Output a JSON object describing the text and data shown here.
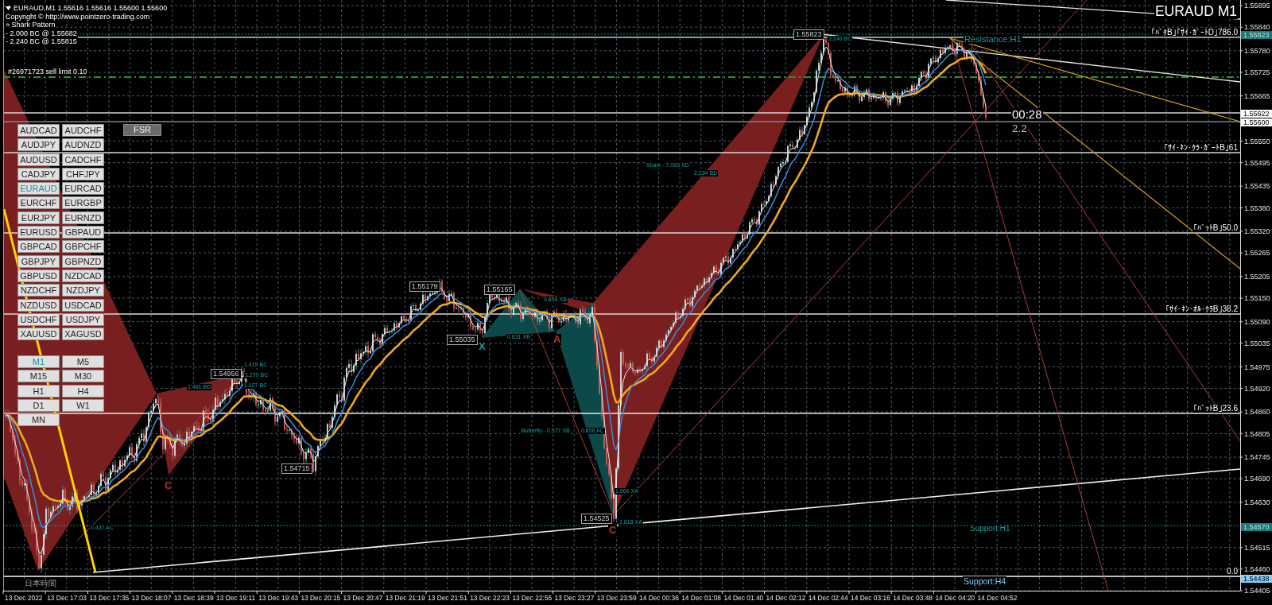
{
  "chart_header": {
    "symbol_line": "EURAUD,M1 1.55616 1.55616 1.55600 1.55600",
    "indicator_lines": [
      "Copyright © http://www.pointzero-trading.com",
      "» Shark Pattern",
      "- 2.000 BC @ 1.55682",
      "- 2.240 BC @ 1.55815"
    ]
  },
  "order_label": "#26971723 sell limit 0.10",
  "chart_title": "EURAUD M1",
  "candle_timer": {
    "countdown": "00:28",
    "spread": "2.2"
  },
  "level_labels": [
    "｢ﾊﾞﾀB｣｢ｻｲ･ｶﾞｰﾄD｣786.0",
    "｢ｻｲ･ﾈﾝ･ｸﾗ･ｶﾞｰﾄB｣61",
    "｢ﾊﾞｯﾄB｣50.0",
    "｢ｻｲ･ﾈﾝ･ｵﾙ･ｸﾗB｣38.2",
    "｢ﾊﾞｯﾄB｣23.6",
    "0.0"
  ],
  "zone_labels": [
    {
      "text": "Resistance:H1",
      "color": "#1f9c9c"
    },
    {
      "text": "Support:H1",
      "color": "#1f9c9c"
    },
    {
      "text": "Support:H4",
      "color": "#87cefa"
    }
  ],
  "point_labels": [
    "1.55823",
    "1.55179",
    "1.55165",
    "1.55035",
    "1.54956",
    "1.54715",
    "1.54525"
  ],
  "pattern_notes": [
    "2.240 BC",
    "Shark - 7.093 XD",
    "2.234 BD",
    "0.659 XB",
    "0.631 XB",
    "1.419 BC",
    "1.270 BC",
    "1.461 BD",
    "1.127 BC",
    "Butterfly - 0.577 XB",
    "0.858 AC",
    "1.000 XA",
    "1.618 XA",
    "0.437 AC"
  ],
  "point_letters": [
    {
      "text": "A",
      "color": "#b8322e"
    },
    {
      "text": "X",
      "color": "#1f9c9c"
    },
    {
      "text": "C",
      "color": "#b8322e"
    },
    {
      "text": "C",
      "color": "#b8322e"
    }
  ],
  "symbol_buttons": [
    {
      "label": "AUDCAD",
      "selected": false
    },
    {
      "label": "AUDCHF",
      "selected": false
    },
    {
      "label": "AUDJPY",
      "selected": false
    },
    {
      "label": "AUDNZD",
      "selected": false
    },
    {
      "label": "AUDUSD",
      "selected": false
    },
    {
      "label": "CADCHF",
      "selected": false
    },
    {
      "label": "CADJPY",
      "selected": false
    },
    {
      "label": "CHFJPY",
      "selected": false
    },
    {
      "label": "EURAUD",
      "selected": true
    },
    {
      "label": "EURCAD",
      "selected": false
    },
    {
      "label": "EURCHF",
      "selected": false
    },
    {
      "label": "EURGBP",
      "selected": false
    },
    {
      "label": "EURJPY",
      "selected": false
    },
    {
      "label": "EURNZD",
      "selected": false
    },
    {
      "label": "EURUSD",
      "selected": false
    },
    {
      "label": "GBPAUD",
      "selected": false
    },
    {
      "label": "GBPCAD",
      "selected": false
    },
    {
      "label": "GBPCHF",
      "selected": false
    },
    {
      "label": "GBPJPY",
      "selected": false
    },
    {
      "label": "GBPNZD",
      "selected": false
    },
    {
      "label": "GBPUSD",
      "selected": false
    },
    {
      "label": "NZDCAD",
      "selected": false
    },
    {
      "label": "NZDCHF",
      "selected": false
    },
    {
      "label": "NZDJPY",
      "selected": false
    },
    {
      "label": "NZDUSD",
      "selected": false
    },
    {
      "label": "USDCAD",
      "selected": false
    },
    {
      "label": "USDCHF",
      "selected": false
    },
    {
      "label": "USDJPY",
      "selected": false
    },
    {
      "label": "XAUUSD",
      "selected": false
    },
    {
      "label": "XAGUSD",
      "selected": false
    }
  ],
  "fsr_button": {
    "label": "FSR"
  },
  "timeframe_buttons": [
    {
      "label": "M1",
      "selected": true
    },
    {
      "label": "M5",
      "selected": false
    },
    {
      "label": "M15",
      "selected": false
    },
    {
      "label": "M30",
      "selected": false
    },
    {
      "label": "H1",
      "selected": false
    },
    {
      "label": "H4",
      "selected": false
    },
    {
      "label": "D1",
      "selected": false
    },
    {
      "label": "W1",
      "selected": false
    },
    {
      "label": "MN",
      "selected": false
    }
  ],
  "time_zone_label": "日本時間",
  "price_axis": {
    "labels": [
      "1.55895",
      "1.55840",
      "1.55780",
      "1.55725",
      "1.55665",
      "1.55550",
      "1.55495",
      "1.55435",
      "1.55380",
      "1.55320",
      "1.55265",
      "1.55205",
      "1.55150",
      "1.55090",
      "1.55035",
      "1.54975",
      "1.54920",
      "1.54860",
      "1.54805",
      "1.54745",
      "1.54690",
      "1.54630",
      "1.54515",
      "1.54460",
      "1.54405"
    ],
    "markers": [
      {
        "text": "1.55823",
        "color": "#137a7a"
      },
      {
        "text": "1.55622",
        "color": "#ffffff"
      },
      {
        "text": "1.55600",
        "color": "#ffffff"
      },
      {
        "text": "1.54570",
        "color": "#137a7a"
      },
      {
        "text": "1.54438",
        "color": "#87cefa"
      }
    ]
  },
  "time_axis": {
    "labels": [
      "13 Dec 2022",
      "13 Dec 17:03",
      "13 Dec 17:35",
      "13 Dec 18:07",
      "13 Dec 18:39",
      "13 Dec 19:11",
      "13 Dec 19:43",
      "13 Dec 20:15",
      "13 Dec 20:47",
      "13 Dec 21:19",
      "13 Dec 21:51",
      "13 Dec 22:23",
      "13 Dec 22:55",
      "13 Dec 23:27",
      "13 Dec 23:59",
      "14 Dec 00:36",
      "14 Dec 01:08",
      "14 Dec 01:40",
      "14 Dec 02:12",
      "14 Dec 02:44",
      "14 Dec 03:16",
      "14 Dec 03:48",
      "14 Dec 04:20",
      "14 Dec 04:52"
    ]
  }
}
